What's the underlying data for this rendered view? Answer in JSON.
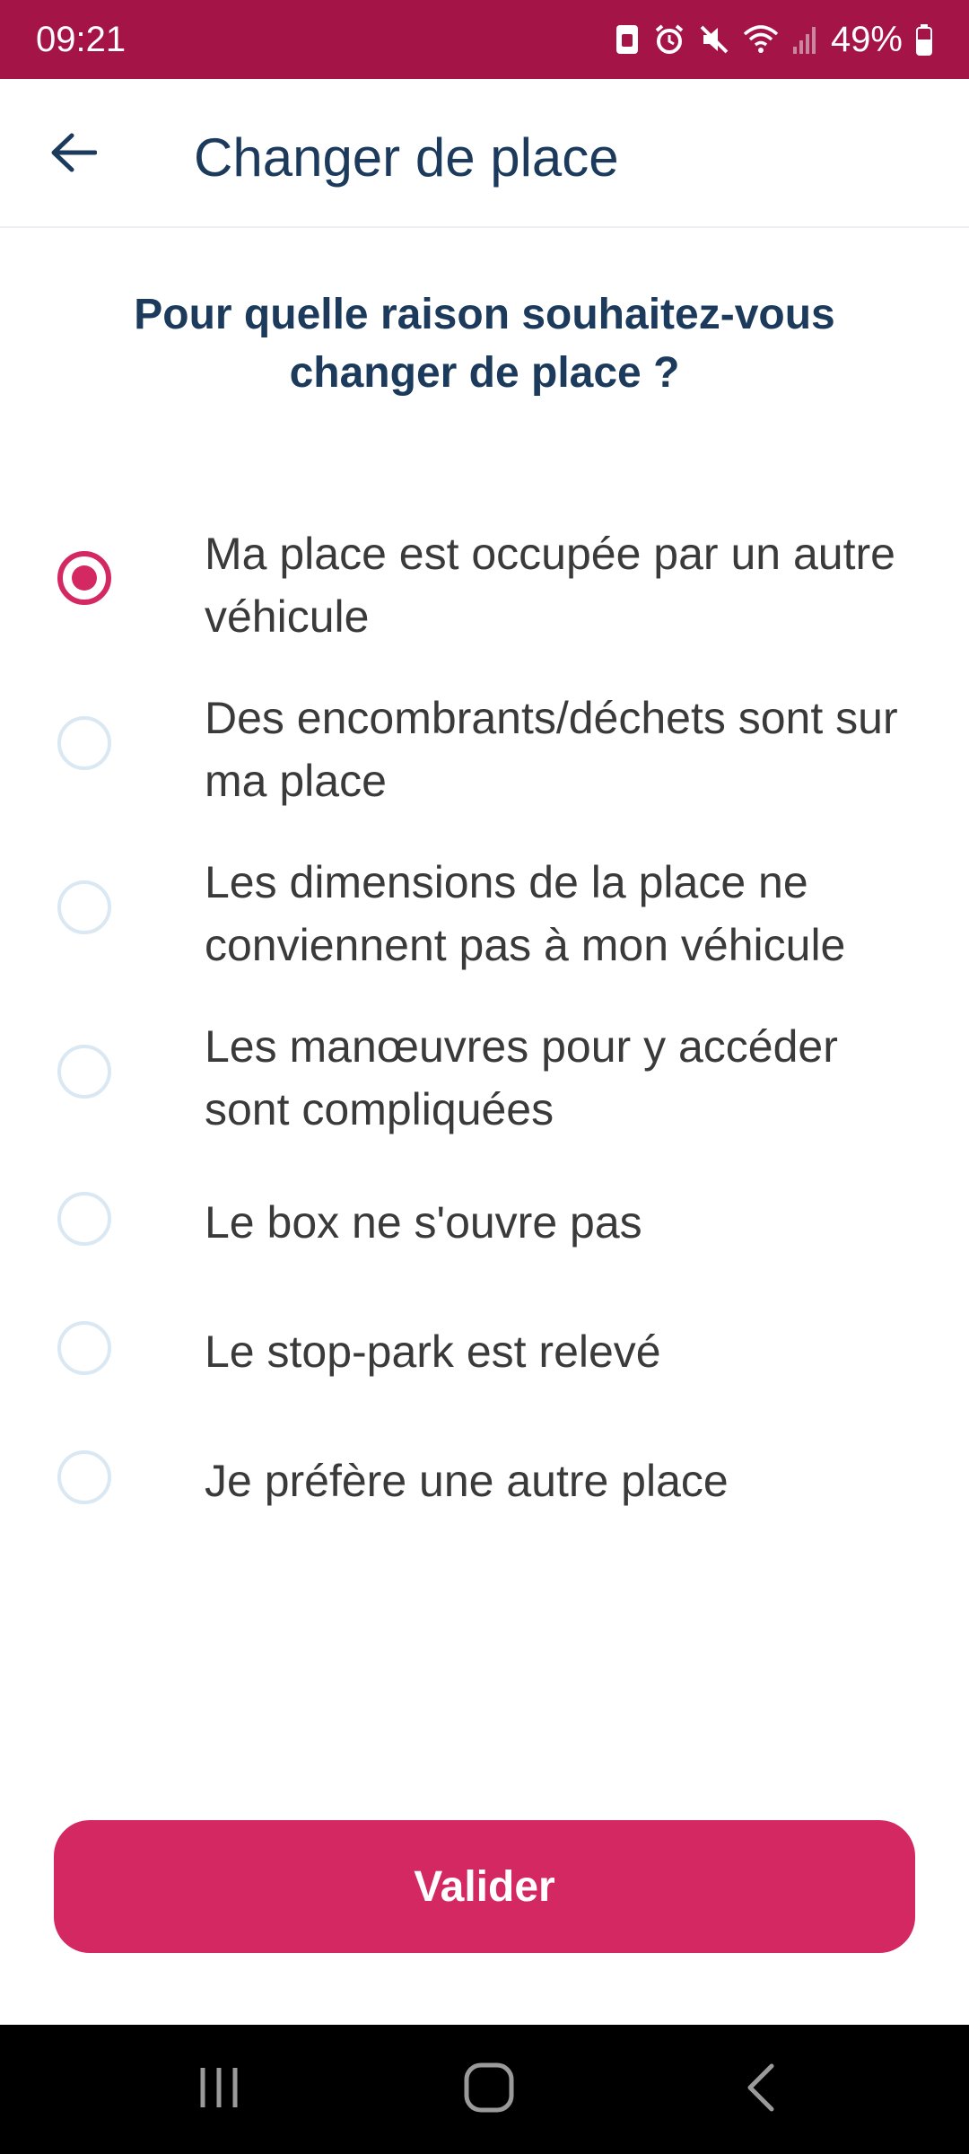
{
  "status_bar": {
    "time": "09:21",
    "battery": "49%",
    "icons": [
      "sim-icon",
      "alarm-icon",
      "mute-icon",
      "wifi-icon",
      "signal-icon",
      "battery-icon"
    ],
    "background": "#a51447"
  },
  "app_bar": {
    "title": "Changer de place",
    "back_icon": "arrow-left-icon"
  },
  "question": "Pour quelle raison souhaitez-vous changer de place ?",
  "options": [
    {
      "label": "Ma place est occupée par un autre véhicule",
      "selected": true
    },
    {
      "label": "Des encombrants/déchets sont sur ma place",
      "selected": false
    },
    {
      "label": "Les dimensions de la place ne conviennent pas à mon véhicule",
      "selected": false
    },
    {
      "label": "Les manœuvres pour y accéder sont compliquées",
      "selected": false
    },
    {
      "label": "Le box ne s'ouvre pas",
      "selected": false
    },
    {
      "label": "Le stop-park est relevé",
      "selected": false
    },
    {
      "label": "Je préfère une autre place",
      "selected": false
    }
  ],
  "validate_button": "Valider",
  "colors": {
    "accent": "#d42862",
    "title_text": "#1b3a5c",
    "radio_unselected": "#d9e8f3"
  },
  "nav_bar": {
    "icons": [
      "recent-apps-icon",
      "home-icon",
      "back-icon"
    ]
  }
}
